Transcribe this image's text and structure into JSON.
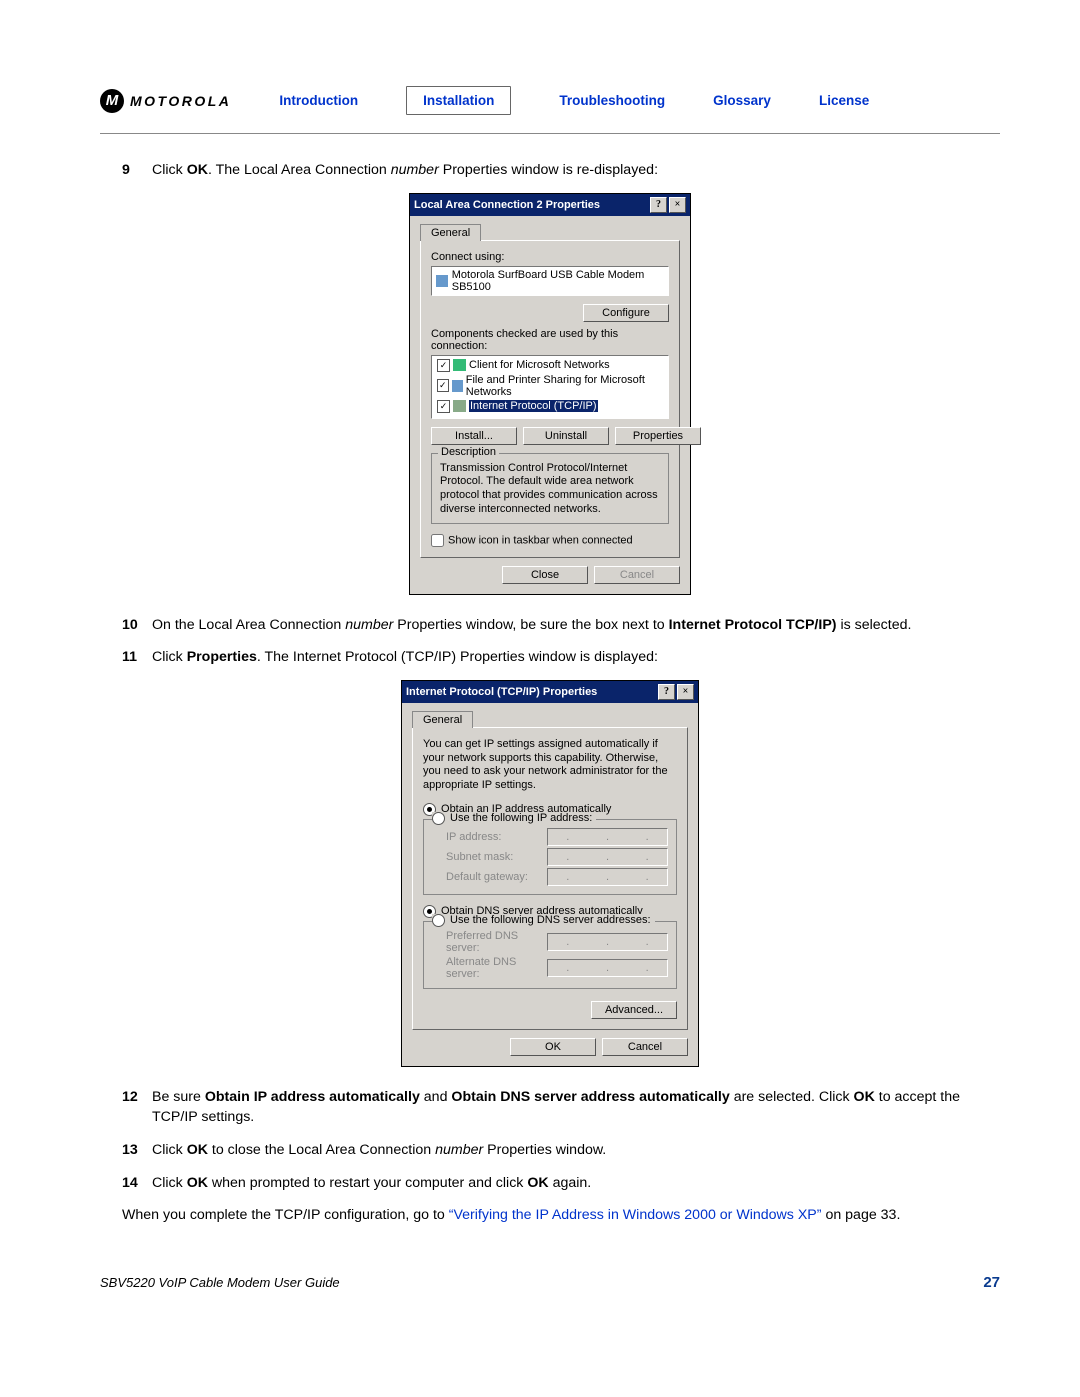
{
  "header": {
    "brand": "MOTOROLA",
    "logo_initial": "M",
    "nav": [
      "Introduction",
      "Installation",
      "Troubleshooting",
      "Glossary",
      "License"
    ]
  },
  "steps": {
    "s9": {
      "num": "9",
      "pre": "Click ",
      "b1": "OK",
      "post1": ". The Local Area Connection ",
      "i1": "number",
      "post2": " Properties window is re-displayed:"
    },
    "s10": {
      "num": "10",
      "pre": "On the Local Area Connection ",
      "i1": "number",
      "mid": " Properties window, be sure the box next to ",
      "b1": "Internet Protocol TCP/IP)",
      "post": " is selected."
    },
    "s11": {
      "num": "11",
      "pre": "Click ",
      "b1": "Properties",
      "post": ". The Internet Protocol (TCP/IP) Properties window is displayed:"
    },
    "s12": {
      "num": "12",
      "pre": "Be sure ",
      "b1": "Obtain IP address automatically",
      "mid": " and ",
      "b2": "Obtain DNS server address automatically",
      "post1": " are selected. Click ",
      "b3": "OK",
      "post2": " to accept the TCP/IP settings."
    },
    "s13": {
      "num": "13",
      "pre": "Click ",
      "b1": "OK",
      "mid": " to close the Local Area Connection ",
      "i1": "number",
      "post": " Properties window."
    },
    "s14": {
      "num": "14",
      "pre": "Click ",
      "b1": "OK",
      "mid": " when prompted to restart your computer and click ",
      "b2": "OK",
      "post": " again."
    }
  },
  "closing": {
    "pre": "When you complete the TCP/IP configuration, go to ",
    "link": "“Verifying the IP Address in Windows 2000 or Windows XP”",
    "post": " on page 33."
  },
  "dlg1": {
    "title": "Local Area Connection 2 Properties",
    "tab": "General",
    "connect_label": "Connect using:",
    "adapter": "Motorola SurfBoard USB Cable Modem SB5100",
    "configure": "Configure",
    "components_label": "Components checked are used by this connection:",
    "items": [
      "Client for Microsoft Networks",
      "File and Printer Sharing for Microsoft Networks",
      "Internet Protocol (TCP/IP)"
    ],
    "install": "Install...",
    "uninstall": "Uninstall",
    "properties": "Properties",
    "desc_title": "Description",
    "desc": "Transmission Control Protocol/Internet Protocol. The default wide area network protocol that provides communication across diverse interconnected networks.",
    "show_icon": "Show icon in taskbar when connected",
    "close": "Close",
    "cancel": "Cancel"
  },
  "dlg2": {
    "title": "Internet Protocol (TCP/IP) Properties",
    "tab": "General",
    "intro": "You can get IP settings assigned automatically if your network supports this capability. Otherwise, you need to ask your network administrator for the appropriate IP settings.",
    "r1": "Obtain an IP address automatically",
    "r2": "Use the following IP address:",
    "ip": "IP address:",
    "mask": "Subnet mask:",
    "gw": "Default gateway:",
    "r3": "Obtain DNS server address automatically",
    "r4": "Use the following DNS server addresses:",
    "pdns": "Preferred DNS server:",
    "adns": "Alternate DNS server:",
    "advanced": "Advanced...",
    "ok": "OK",
    "cancel": "Cancel"
  },
  "footer": {
    "guide": "SBV5220 VoIP Cable Modem User Guide",
    "page": "27"
  }
}
